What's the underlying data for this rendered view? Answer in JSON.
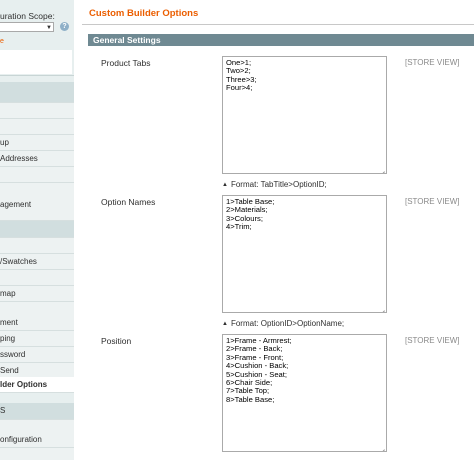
{
  "sidebar": {
    "scope_label": "uration Scope:",
    "scope_value": "e",
    "items": [
      {
        "label": ""
      },
      {
        "label": ""
      },
      {
        "label": "up"
      },
      {
        "label": "Addresses"
      },
      {
        "label": ""
      },
      {
        "label": "agement"
      },
      {
        "label": ""
      },
      {
        "label": "/Swatches"
      },
      {
        "label": ""
      },
      {
        "label": "map"
      },
      {
        "label": ""
      },
      {
        "label": "ment"
      },
      {
        "label": "ping"
      },
      {
        "label": "ssword"
      },
      {
        "label": "Send"
      },
      {
        "label": "lder Options"
      },
      {
        "label": "S"
      },
      {
        "label": "onfiguration"
      },
      {
        "label": ""
      }
    ]
  },
  "main": {
    "title": "Custom Builder Options",
    "section_title": "General Settings",
    "rows": [
      {
        "label": "Product Tabs",
        "scope": "[STORE VIEW]",
        "value": "One>1;\nTwo>2;\nThree>3;\nFour>4;",
        "hint": "Format: TabTitle>OptionID;"
      },
      {
        "label": "Option Names",
        "scope": "[STORE VIEW]",
        "value": "1>Table Base;\n2>Materials;\n3>Colours;\n4>Trim;",
        "hint": "Format: OptionID>OptionName;"
      },
      {
        "label": "Position",
        "scope": "[STORE VIEW]",
        "value": "1>Frame - Armrest;\n2>Frame - Back;\n3>Frame - Front;\n4>Cushion - Back;\n5>Cushion - Seat;\n6>Chair Side;\n7>Table Top;\n8>Table Base;"
      }
    ]
  }
}
